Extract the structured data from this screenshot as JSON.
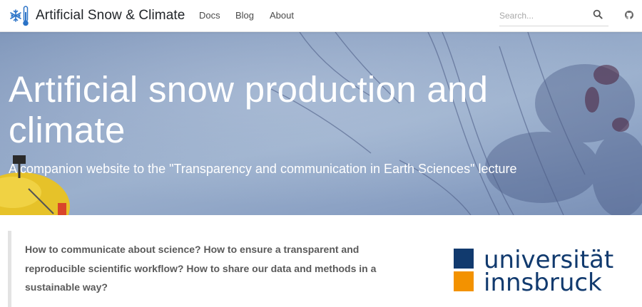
{
  "header": {
    "brand_title": "Artificial Snow & Climate",
    "nav": [
      {
        "label": "Docs"
      },
      {
        "label": "Blog"
      },
      {
        "label": "About"
      }
    ],
    "search": {
      "placeholder": "Search..."
    }
  },
  "hero": {
    "title": "Artificial snow production and climate",
    "subtitle": "A companion website to the \"Transparency and communication in Earth Sciences\" lecture"
  },
  "intro": {
    "text": "How to communicate about science? How to ensure a transparent and reproducible scientific workflow? How to share our data and methods in a sustainable way?"
  },
  "university_logo": {
    "line1": "universität",
    "line2": "innsbruck",
    "colors": {
      "blue": "#113a6e",
      "orange": "#f39200"
    }
  },
  "colors": {
    "icon_blue": "#2b73c7",
    "nav_text": "#4a4a4a"
  }
}
